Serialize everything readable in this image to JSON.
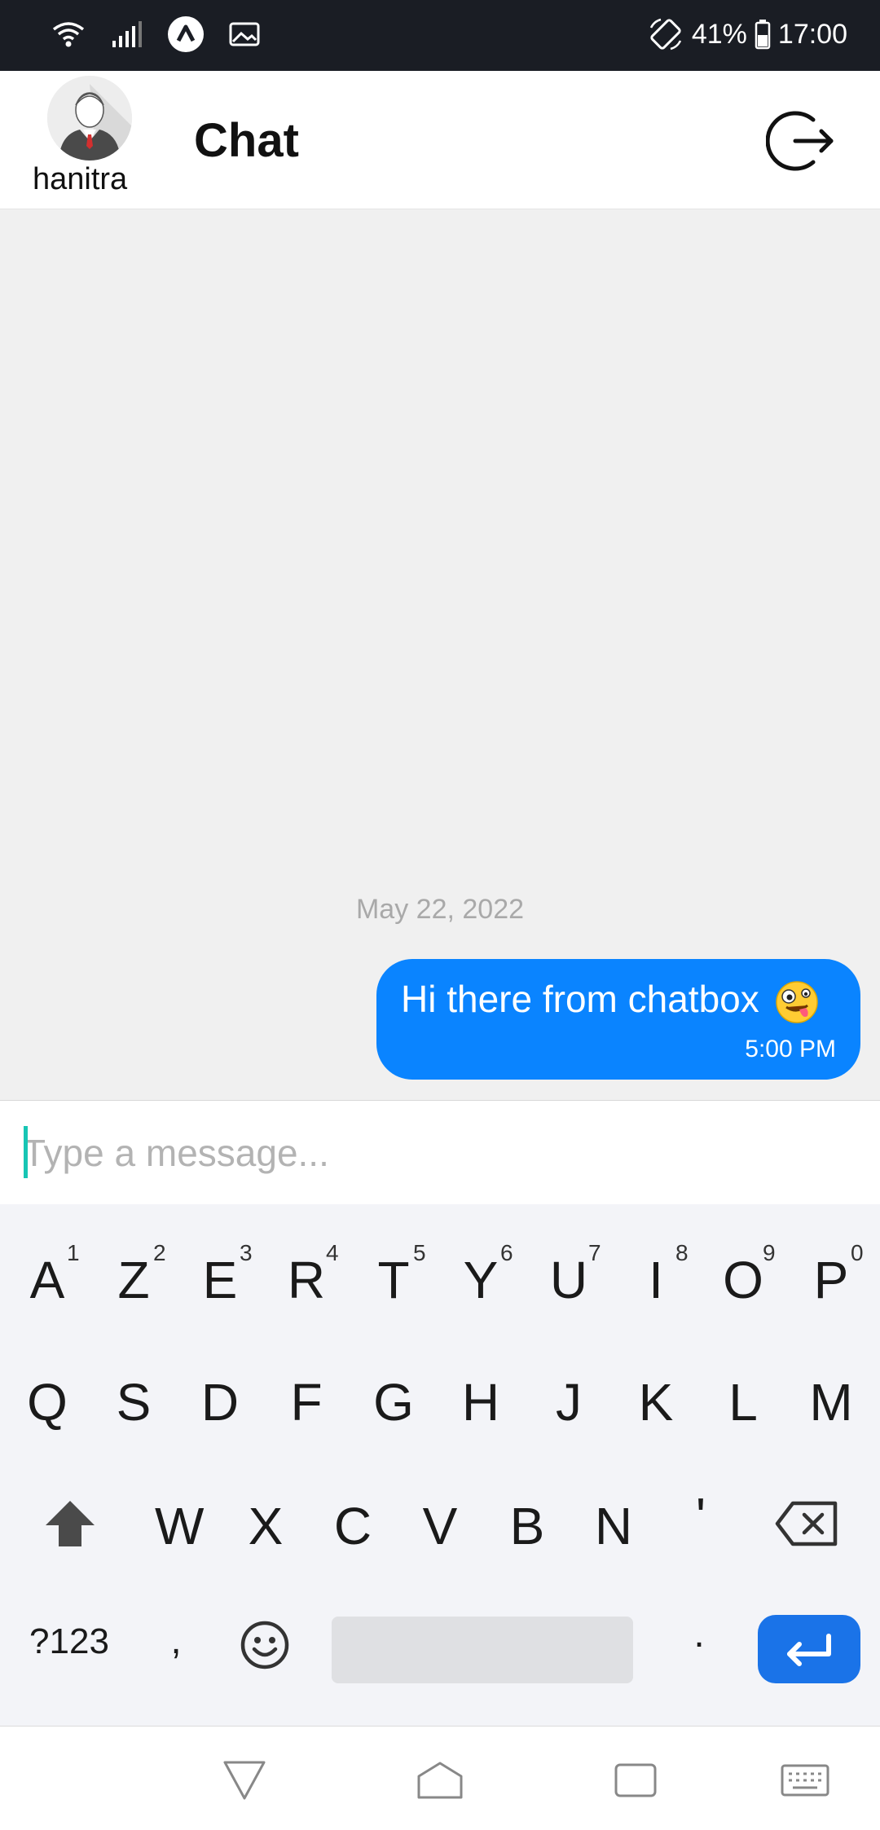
{
  "status_bar": {
    "battery_percent": "41%",
    "time": "17:00",
    "icons": [
      "wifi-icon",
      "signal-icon",
      "app-notification-icon",
      "gallery-icon",
      "rotate-icon",
      "battery-icon"
    ]
  },
  "header": {
    "username": "hanitra",
    "title": "Chat",
    "logout_icon": "logout-icon"
  },
  "chat": {
    "date_separator": "May 22, 2022",
    "messages": [
      {
        "text": "Hi there from chatbox",
        "emoji": "zany-face",
        "time": "5:00 PM",
        "sender": "me"
      }
    ]
  },
  "composer": {
    "placeholder": "Type a message...",
    "value": ""
  },
  "keyboard": {
    "row1": [
      {
        "key": "A",
        "sup": "1"
      },
      {
        "key": "Z",
        "sup": "2"
      },
      {
        "key": "E",
        "sup": "3"
      },
      {
        "key": "R",
        "sup": "4"
      },
      {
        "key": "T",
        "sup": "5"
      },
      {
        "key": "Y",
        "sup": "6"
      },
      {
        "key": "U",
        "sup": "7"
      },
      {
        "key": "I",
        "sup": "8"
      },
      {
        "key": "O",
        "sup": "9"
      },
      {
        "key": "P",
        "sup": "0"
      }
    ],
    "row2": [
      "Q",
      "S",
      "D",
      "F",
      "G",
      "H",
      "J",
      "K",
      "L",
      "M"
    ],
    "row3": [
      "W",
      "X",
      "C",
      "V",
      "B",
      "N",
      "'"
    ],
    "symbols_label": "?123",
    "comma": ",",
    "period": "."
  },
  "colors": {
    "accent": "#0a84ff",
    "enter_key": "#1a73e8",
    "caret": "#17c5b4",
    "status_bar": "#1a1d24"
  }
}
